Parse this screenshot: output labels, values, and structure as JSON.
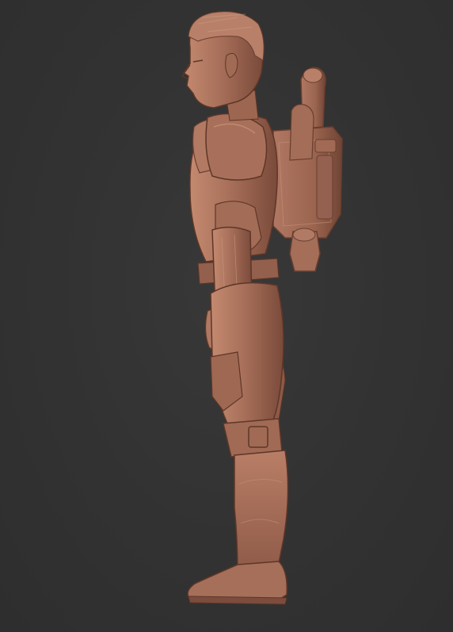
{
  "scene": {
    "subject": "sculpted-figure-side-view",
    "background_color": "#333333",
    "material_color": "#a8705a",
    "material_highlight": "#c89078",
    "material_shadow": "#6e4234"
  }
}
